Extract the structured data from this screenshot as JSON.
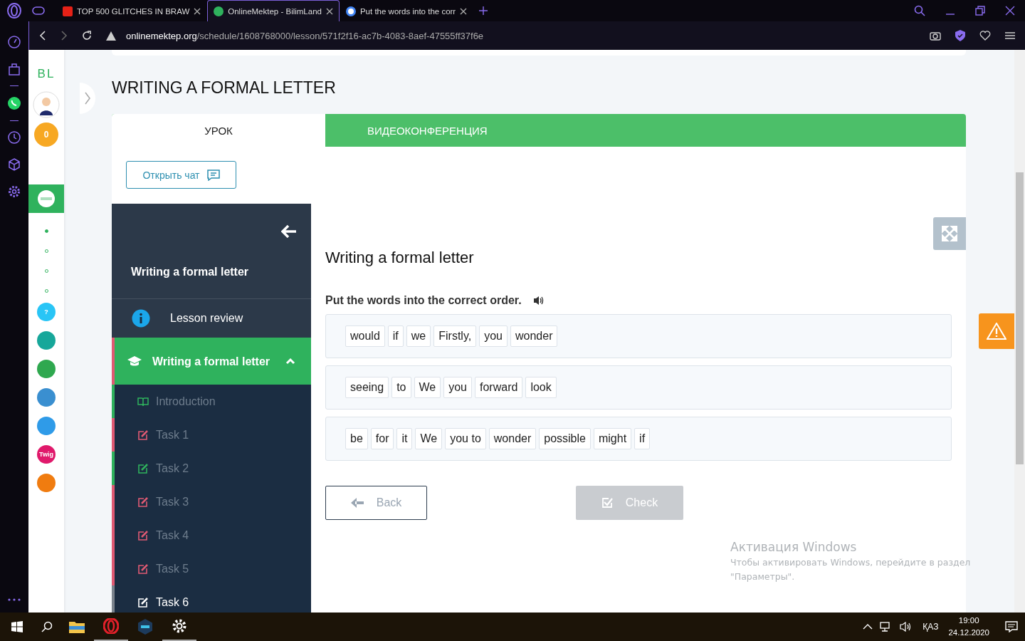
{
  "browser_tabs": [
    {
      "title": "TOP 500 GLITCHES IN BRAW",
      "selected": false,
      "kind": "video"
    },
    {
      "title": "OnlineMektep - BilimLand",
      "selected": true,
      "kind": "bilim"
    },
    {
      "title": "Put the words into the corr",
      "selected": false,
      "kind": "google"
    }
  ],
  "address_bar": {
    "host": "onlinemektep.org",
    "path": "/schedule/1608768000/lesson/571f2f16-ac7b-4083-8aef-47555ff37f6e"
  },
  "site_sidebar": {
    "logo": "BL",
    "coins": "0",
    "dots": [
      {
        "selected": true
      },
      {
        "selected": false
      },
      {
        "selected": false
      },
      {
        "selected": false
      }
    ],
    "apps": [
      {
        "label": "?",
        "color": "#29c5f6"
      },
      {
        "color": "#17a79a"
      },
      {
        "color": "#2fa84f"
      },
      {
        "color": "#3a8fd0"
      },
      {
        "color": "#2f9be8"
      },
      {
        "label": "Twig",
        "color": "#e0196b"
      },
      {
        "color": "#f07c10"
      }
    ]
  },
  "page_title": "WRITING A FORMAL LETTER",
  "lesson_tabs": [
    {
      "label": "УРОК",
      "selected": true
    },
    {
      "label": "ВИДЕОКОНФЕРЕНЦИЯ",
      "selected": false
    }
  ],
  "chat_button": "Открыть чат",
  "nav": {
    "title": "Writing a formal letter",
    "review": "Lesson review",
    "section": {
      "title": "Writing a formal letter",
      "expanded": true
    },
    "items": [
      {
        "label": "Introduction",
        "kind": "reading",
        "color": "#2fb25d",
        "selected": false
      },
      {
        "label": "Task 1",
        "kind": "task",
        "color": "#e05a73",
        "selected": false
      },
      {
        "label": "Task 2",
        "kind": "task",
        "color": "#2fb25d",
        "selected": false
      },
      {
        "label": "Task 3",
        "kind": "task",
        "color": "#e05a73",
        "selected": false
      },
      {
        "label": "Task 4",
        "kind": "task",
        "color": "#e05a73",
        "selected": false
      },
      {
        "label": "Task 5",
        "kind": "task",
        "color": "#e05a73",
        "selected": false
      },
      {
        "label": "Task 6",
        "kind": "task",
        "color": "#7b838d",
        "selected": true
      }
    ]
  },
  "exercise": {
    "title": "Writing a formal letter",
    "instruction": "Put the words into the correct order.",
    "sentences": [
      {
        "words": [
          "would",
          "if",
          "we",
          "Firstly,",
          "you",
          "wonder"
        ]
      },
      {
        "words": [
          "seeing",
          "to",
          "We",
          "you",
          "forward",
          "look"
        ]
      },
      {
        "words": [
          "be",
          "for",
          "it",
          "We",
          "you to",
          "wonder",
          "possible",
          "might",
          "if"
        ]
      }
    ],
    "back": "Back",
    "check": {
      "label": "Check",
      "disabled": true
    }
  },
  "activation": {
    "title": "Активация Windows",
    "text": "Чтобы активировать Windows, перейдите в раздел \"Параметры\"."
  },
  "taskbar": {
    "language": "ҚАЗ",
    "time": "19:00",
    "date": "24.12.2020"
  }
}
